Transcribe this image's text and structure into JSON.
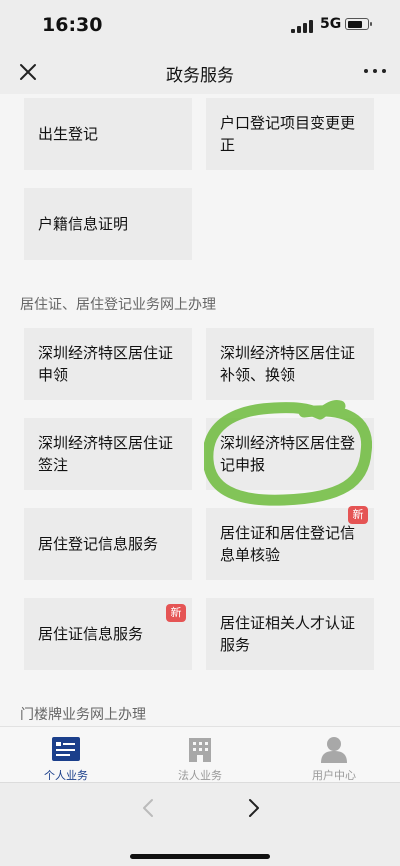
{
  "status_bar": {
    "time": "16:30",
    "network": "5G"
  },
  "nav": {
    "title": "政务服务"
  },
  "services_top": [
    {
      "label": "出生登记"
    },
    {
      "label": "户口登记项目变更更正"
    },
    {
      "label": "户籍信息证明"
    }
  ],
  "section_residence": {
    "title": "居住证、居住登记业务网上办理"
  },
  "services_residence": [
    {
      "label": "深圳经济特区居住证申领"
    },
    {
      "label": "深圳经济特区居住证补领、换领"
    },
    {
      "label": "深圳经济特区居住证签注"
    },
    {
      "label": "深圳经济特区居住登记申报"
    },
    {
      "label": "居住登记信息服务"
    },
    {
      "label": "居住证和居住登记信息单核验",
      "badge": "新"
    },
    {
      "label": "居住证信息服务",
      "badge": "新"
    },
    {
      "label": "居住证相关人才认证服务"
    }
  ],
  "section_doorplate": {
    "title": "门楼牌业务网上办理"
  },
  "tabs": [
    {
      "label": "个人业务",
      "active": true
    },
    {
      "label": "法人业务",
      "active": false
    },
    {
      "label": "用户中心",
      "active": false
    }
  ],
  "colors": {
    "accent": "#1b3f8b",
    "badge": "#e55454",
    "highlight_circle": "#6dbb3c"
  }
}
